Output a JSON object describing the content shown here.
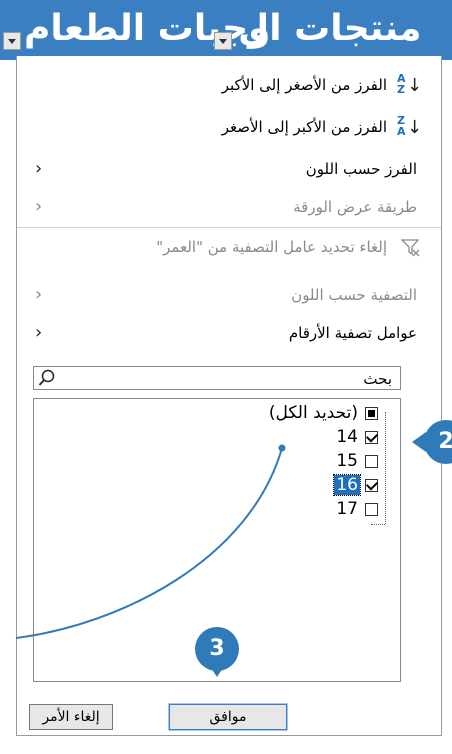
{
  "header": {
    "col1_title": "وجبات الطعام",
    "col2_title": "منتجات ال"
  },
  "menu": {
    "sort_asc": "الفرز من الأصغر إلى الأكبر",
    "sort_desc": "الفرز من الأكبر إلى الأصغر",
    "sort_by_color": "الفرز حسب اللون",
    "sheet_view": "طريقة عرض الورقة",
    "clear_filter": "إلغاء تحديد عامل التصفية من \"العمر\"",
    "filter_by_color": "التصفية حسب اللون",
    "number_filters": "عوامل تصفية الأرقام"
  },
  "search": {
    "placeholder": "بحث"
  },
  "list": {
    "select_all": "(تحديد الكل)",
    "items": [
      {
        "label": "14",
        "checked": true
      },
      {
        "label": "15",
        "checked": false
      },
      {
        "label": "16",
        "checked": true
      },
      {
        "label": "17",
        "checked": false
      }
    ]
  },
  "buttons": {
    "ok": "موافق",
    "cancel": "إلغاء الأمر"
  },
  "badges": {
    "step_2": "2",
    "step_3": "3"
  },
  "colors": {
    "header_bg": "#3a7fc1",
    "badge": "#2f7ab8",
    "accent": "#1f6fc0"
  }
}
